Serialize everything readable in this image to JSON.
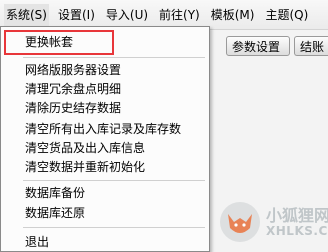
{
  "menubar": {
    "items": [
      {
        "label": "系统(S)"
      },
      {
        "label": "设置(I)"
      },
      {
        "label": "导入(U)"
      },
      {
        "label": "前往(Y)"
      },
      {
        "label": "模板(M)"
      },
      {
        "label": "主题(Q)"
      }
    ]
  },
  "toolbar": {
    "buttons": [
      {
        "label": "参数设置"
      },
      {
        "label": "结账"
      }
    ]
  },
  "dropdown": {
    "items": [
      {
        "label": "更换帐套"
      },
      {
        "label": "网络版服务器设置"
      },
      {
        "label": "清理冗余盘点明细"
      },
      {
        "label": "清除历史结存数据"
      },
      {
        "label": "清空所有出入库记录及库存数"
      },
      {
        "label": "清空货品及出入库信息"
      },
      {
        "label": "清空数据并重新初始化"
      },
      {
        "label": "数据库备份"
      },
      {
        "label": "数据库还原"
      },
      {
        "label": "退出"
      }
    ]
  },
  "watermark": {
    "name": "小狐狸网",
    "domain": "XHLKS.CN"
  },
  "colors": {
    "highlight": "#e8363a"
  }
}
